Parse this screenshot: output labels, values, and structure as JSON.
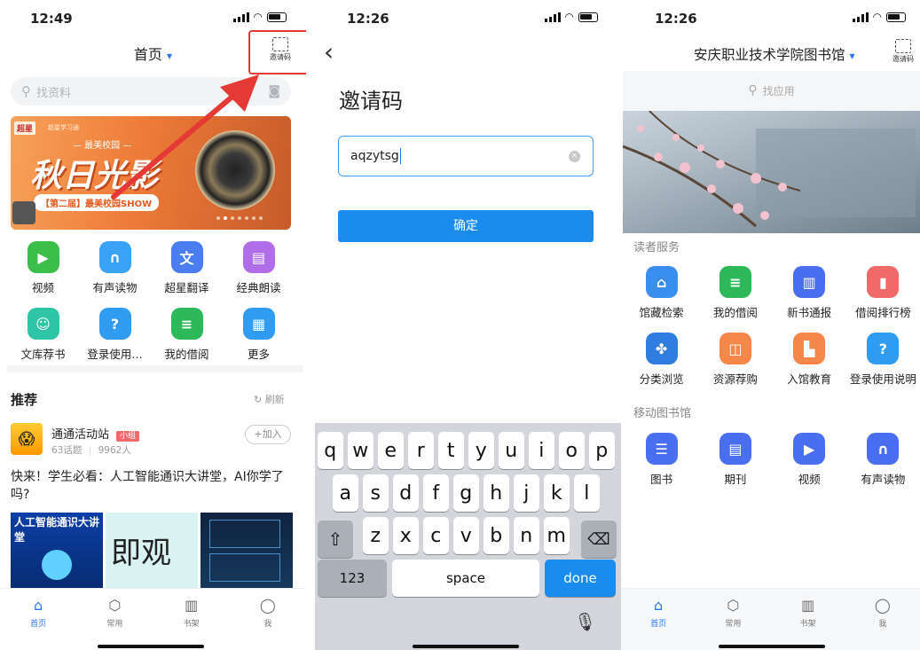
{
  "screen1": {
    "time": "12:49",
    "header_title": "首页",
    "header_chevron": "▾",
    "scan_label": "邀请码",
    "search_placeholder": "找资料",
    "banner": {
      "logo_text": "超星",
      "tag": "超星学习通",
      "subtitle": "— 最美校园 —",
      "title": "秋日光影",
      "badge": "【第二届】最美校园SHOW"
    },
    "apps": [
      {
        "label": "视频",
        "color": "#3cbf4a",
        "icon": "video-icon"
      },
      {
        "label": "有声读物",
        "color": "#3aa3f5",
        "icon": "headphones-icon"
      },
      {
        "label": "超星翻译",
        "color": "#4a7df0",
        "icon": "translate-icon"
      },
      {
        "label": "经典朗读",
        "color": "#b06ee8",
        "icon": "book-icon"
      },
      {
        "label": "文库荐书",
        "color": "#2ec4a6",
        "icon": "reader-icon"
      },
      {
        "label": "登录使用…",
        "color": "#2f9cf2",
        "icon": "help-icon"
      },
      {
        "label": "我的借阅",
        "color": "#2db85a",
        "icon": "document-icon"
      },
      {
        "label": "更多",
        "color": "#2f9cf2",
        "icon": "grid-icon"
      }
    ],
    "recommend_title": "推荐",
    "refresh_label": "刷新",
    "post": {
      "group_name": "通通活动站",
      "group_tag": "小组",
      "topics": "63话题",
      "members": "9962人",
      "join_label": "+加入",
      "title": "快来！学生必看：人工智能通识大讲堂，AI你学了吗?",
      "thumb1_text": "人工智能通识大讲堂",
      "thumb2_text": "即观"
    },
    "tabs": [
      {
        "label": "首页",
        "icon": "home-icon"
      },
      {
        "label": "常用",
        "icon": "compass-icon"
      },
      {
        "label": "书架",
        "icon": "bookshelf-icon"
      },
      {
        "label": "我",
        "icon": "user-icon"
      }
    ]
  },
  "screen2": {
    "time": "12:26",
    "back": "‹",
    "title": "邀请码",
    "input_value": "aqzytsg",
    "confirm_label": "确定",
    "row1": [
      "q",
      "w",
      "e",
      "r",
      "t",
      "y",
      "u",
      "i",
      "o",
      "p"
    ],
    "row2": [
      "a",
      "s",
      "d",
      "f",
      "g",
      "h",
      "j",
      "k",
      "l"
    ],
    "row3": [
      "z",
      "x",
      "c",
      "v",
      "b",
      "n",
      "m"
    ],
    "key_123": "123",
    "key_space": "space",
    "key_done": "done"
  },
  "screen3": {
    "time": "12:26",
    "header_title": "安庆职业技术学院图书馆",
    "header_chevron": "▾",
    "scan_label": "邀请码",
    "search_placeholder": "找应用",
    "section1": "读者服务",
    "services": [
      {
        "label": "馆藏检索",
        "color": "#3a8ef0",
        "icon": "library-icon"
      },
      {
        "label": "我的借阅",
        "color": "#2db85a",
        "icon": "document-icon"
      },
      {
        "label": "新书通报",
        "color": "#4a6ef0",
        "icon": "newbook-icon"
      },
      {
        "label": "借阅排行榜",
        "color": "#f06a6a",
        "icon": "ranking-icon"
      },
      {
        "label": "分类浏览",
        "color": "#2f7de0",
        "icon": "category-icon"
      },
      {
        "label": "资源荐购",
        "color": "#f5874a",
        "icon": "bag-icon"
      },
      {
        "label": "入馆教育",
        "color": "#f5874a",
        "icon": "building-icon"
      },
      {
        "label": "登录使用说明",
        "color": "#2f9cf2",
        "icon": "help-icon"
      }
    ],
    "section2": "移动图书馆",
    "mobile": [
      {
        "label": "图书",
        "color": "#4a6ef0",
        "icon": "books-icon"
      },
      {
        "label": "期刊",
        "color": "#4a6ef0",
        "icon": "journal-icon"
      },
      {
        "label": "视频",
        "color": "#4a6ef0",
        "icon": "video-icon"
      },
      {
        "label": "有声读物",
        "color": "#4a6ef0",
        "icon": "headphones-icon"
      }
    ],
    "tabs": [
      {
        "label": "首页",
        "icon": "home-icon"
      },
      {
        "label": "常用",
        "icon": "compass-icon"
      },
      {
        "label": "书架",
        "icon": "bookshelf-icon"
      },
      {
        "label": "我",
        "icon": "user-icon"
      }
    ]
  },
  "colors": {
    "accent": "#2476f0",
    "button": "#1a8cf0",
    "highlight": "#e53935"
  }
}
